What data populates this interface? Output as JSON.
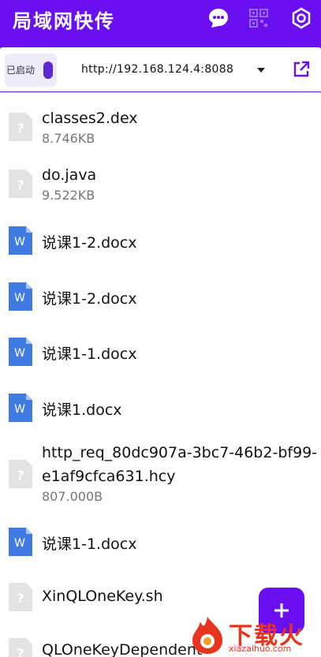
{
  "app": {
    "title": "局域网快传"
  },
  "header": {
    "icons": [
      "chat-icon",
      "qr-code-icon",
      "gear-icon"
    ]
  },
  "server": {
    "toggle_label": "已启动",
    "url": "http://192.168.124.4:8088"
  },
  "files": [
    {
      "name": "classes2.dex",
      "size": "8.746KB",
      "type": "unknown"
    },
    {
      "name": "do.java",
      "size": "9.522KB",
      "type": "unknown"
    },
    {
      "name": "说课1-2.docx",
      "size": "",
      "type": "word"
    },
    {
      "name": "说课1-2.docx",
      "size": "",
      "type": "word"
    },
    {
      "name": "说课1-1.docx",
      "size": "",
      "type": "word"
    },
    {
      "name": "说课1.docx",
      "size": "",
      "type": "word"
    },
    {
      "name": "http_req_80dc907a-3bc7-46b2-bf99-e1af9cfca631.hcy",
      "size": "807.000B",
      "type": "unknown"
    },
    {
      "name": "说课1-1.docx",
      "size": "",
      "type": "word"
    },
    {
      "name": "XinQLOneKey.sh",
      "size": "",
      "type": "unknown"
    },
    {
      "name": "QLOneKeyDependent",
      "size": "",
      "type": "unknown"
    }
  ],
  "fab": {
    "icon": "plus-icon"
  },
  "watermark": {
    "text": "下载火",
    "sub": "xiazaihuo.com"
  },
  "colors": {
    "primary": "#6a0ff0",
    "word_blue": "#3f7be3",
    "unknown_gray": "#e3e3e3",
    "watermark_red": "#e8331f"
  }
}
